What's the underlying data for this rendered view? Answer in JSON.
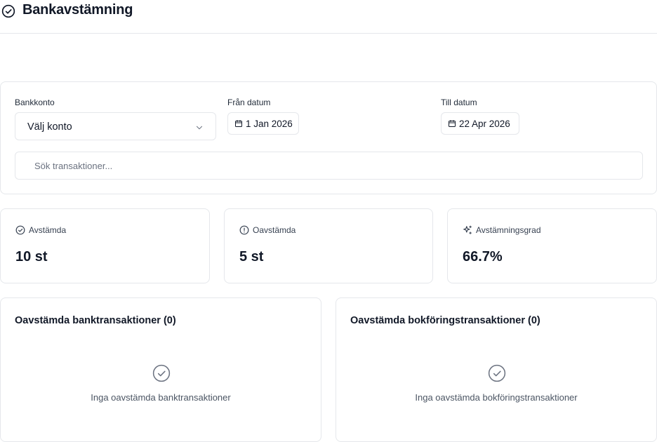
{
  "header": {
    "title": "Bankavstämning",
    "icon": "check-circle-icon"
  },
  "filters": {
    "account": {
      "label": "Bankkonto",
      "value": "Välj konto"
    },
    "from": {
      "label": "Från datum",
      "value": "1 Jan 2026"
    },
    "to": {
      "label": "Till datum",
      "value": "22 Apr 2026"
    },
    "search": {
      "placeholder": "Sök transaktioner..."
    }
  },
  "stats": [
    {
      "label": "Avstämda",
      "value": "10 st",
      "icon": "check-circle-icon"
    },
    {
      "label": "Oavstämda",
      "value": "5 st",
      "icon": "alert-circle-icon"
    },
    {
      "label": "Avstämningsgrad",
      "value": "66.7%",
      "icon": "sparkles-icon"
    }
  ],
  "panels": [
    {
      "title": "Oavstämda banktransaktioner (0)",
      "empty": "Inga oavstämda banktransaktioner"
    },
    {
      "title": "Oavstämda bokföringstransaktioner (0)",
      "empty": "Inga oavstämda bokföringstransaktioner"
    }
  ],
  "colors": {
    "text": "#111827",
    "muted": "#6b7280",
    "border": "#e5e7eb"
  }
}
